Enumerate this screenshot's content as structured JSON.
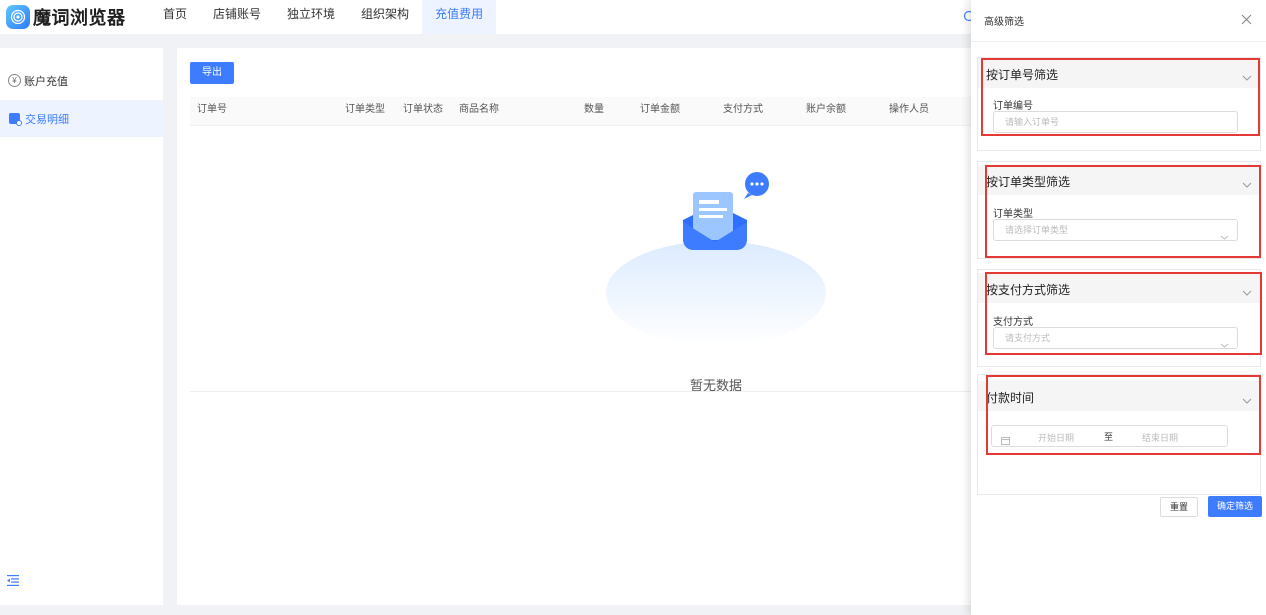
{
  "app": {
    "name": "魔词浏览器"
  },
  "nav": {
    "items": [
      {
        "label": "首页"
      },
      {
        "label": "店铺账号"
      },
      {
        "label": "独立环境"
      },
      {
        "label": "组织架构"
      },
      {
        "label": "充值费用",
        "active": true
      }
    ]
  },
  "sidebar": {
    "items": [
      {
        "label": "账户充值",
        "icon": "yen-icon",
        "active": false
      },
      {
        "label": "交易明细",
        "icon": "transaction-icon",
        "active": true
      }
    ],
    "collapse_icon": "collapse-menu-icon"
  },
  "main": {
    "export_label": "导出",
    "columns": [
      "订单号",
      "订单类型",
      "订单状态",
      "商品名称",
      "数量",
      "订单金额",
      "支付方式",
      "账户余额",
      "操作人员"
    ],
    "empty_text": "暂无数据",
    "empty_icon": "empty-mailbox-icon"
  },
  "drawer": {
    "title": "高级筛选",
    "filters": [
      {
        "title": "按订单号筛选",
        "field_label": "订单编号",
        "placeholder": "请输入订单号",
        "kind": "input"
      },
      {
        "title": "按订单类型筛选",
        "field_label": "订单类型",
        "placeholder": "请选择订单类型",
        "kind": "select"
      },
      {
        "title": "按支付方式筛选",
        "field_label": "支付方式",
        "placeholder": "请支付方式",
        "kind": "select"
      },
      {
        "title": "付款时间",
        "start_placeholder": "开始日期",
        "separator": "至",
        "end_placeholder": "结束日期",
        "kind": "daterange"
      }
    ],
    "reset_label": "重置",
    "confirm_label": "确定筛选"
  },
  "colors": {
    "accent": "#3d7bff",
    "highlight": "#e53935"
  }
}
